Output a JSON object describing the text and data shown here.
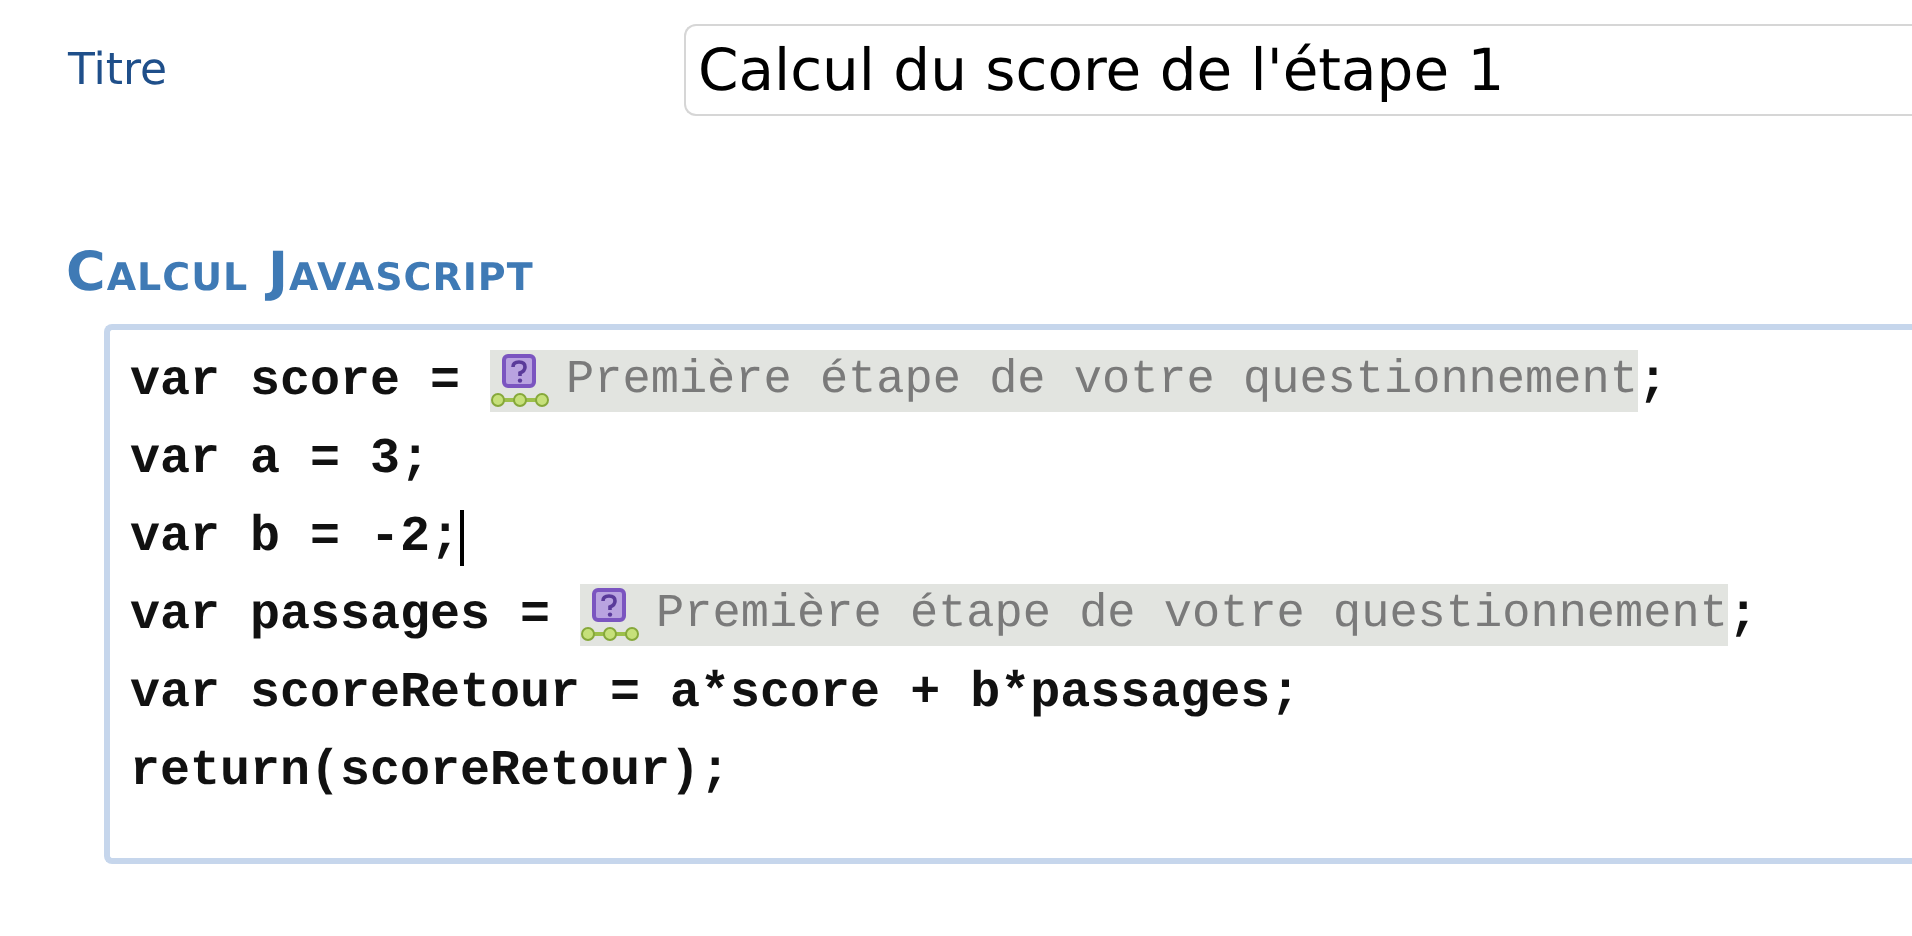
{
  "title_field": {
    "label": "Titre",
    "value": "Calcul du score de l'étape 1"
  },
  "section": {
    "heading": "Calcul Javascript"
  },
  "editor": {
    "lines": [
      {
        "caret": false,
        "segments": [
          {
            "kind": "code",
            "text": "var score = "
          },
          {
            "kind": "token",
            "text": "Première étape de votre questionnement"
          },
          {
            "kind": "code",
            "text": ";"
          }
        ]
      },
      {
        "caret": false,
        "segments": [
          {
            "kind": "code",
            "text": "var a = 3;"
          }
        ]
      },
      {
        "caret": true,
        "segments": [
          {
            "kind": "code",
            "text": "var b = -2;"
          }
        ]
      },
      {
        "caret": false,
        "segments": [
          {
            "kind": "code",
            "text": "var passages = "
          },
          {
            "kind": "token",
            "text": "Première étape de votre questionnement"
          },
          {
            "kind": "code",
            "text": ";"
          }
        ]
      },
      {
        "caret": false,
        "segments": [
          {
            "kind": "code",
            "text": "var scoreRetour = a*score + b*passages;"
          }
        ]
      },
      {
        "caret": false,
        "segments": [
          {
            "kind": "code",
            "text": "return(scoreRetour);"
          }
        ]
      }
    ]
  }
}
